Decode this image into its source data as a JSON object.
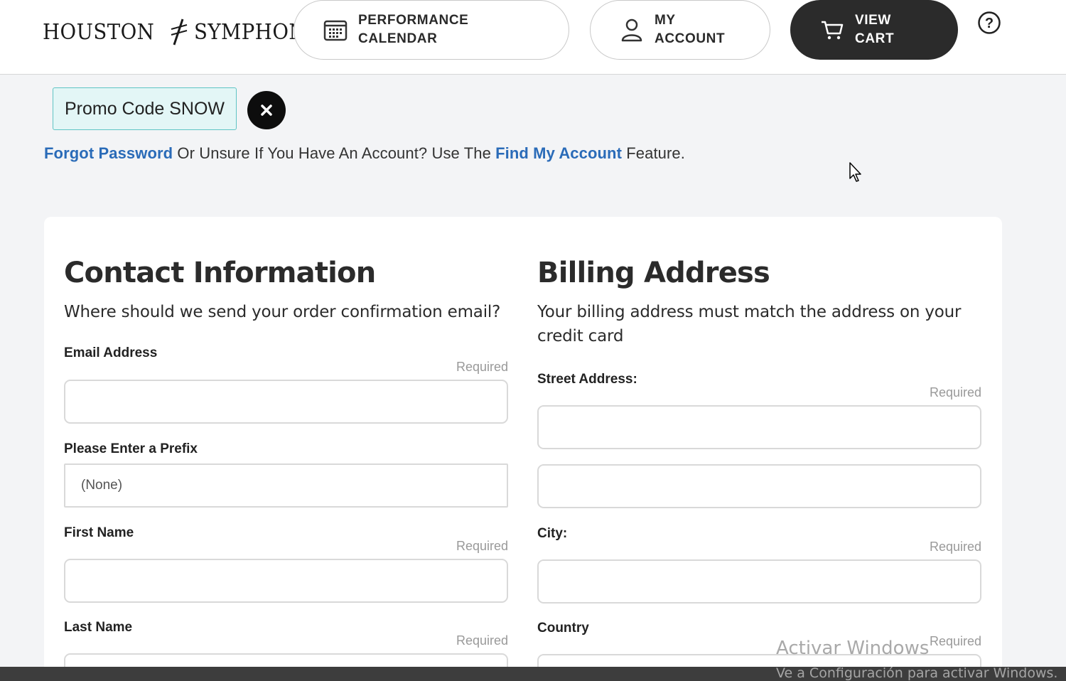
{
  "header": {
    "logo_left": "HOUSTON",
    "logo_right": "SYMPHONY",
    "calendar_label": "PERFORMANCE CALENDAR",
    "account_label": "MY ACCOUNT",
    "cart_label": "VIEW CART",
    "help_icon": "question-circle-icon"
  },
  "promo": {
    "label": "Promo Code SNOW",
    "close_icon": "close-icon"
  },
  "help_line": {
    "forgot_link": "Forgot Password",
    "middle_text": " Or Unsure If You Have An Account? Use The ",
    "find_link": "Find My Account",
    "end_text": " Feature."
  },
  "contact": {
    "title": "Contact Information",
    "subtitle": "Where should we send your order confirmation email?",
    "email_label": "Email Address",
    "email_required": "Required",
    "email_value": "",
    "prefix_label": "Please Enter a Prefix",
    "prefix_value": "(None)",
    "first_name_label": "First Name",
    "first_name_required": "Required",
    "first_name_value": "",
    "last_name_label": "Last Name",
    "last_name_required": "Required"
  },
  "billing": {
    "title": "Billing Address",
    "subtitle": "Your billing address must match the address on your credit card",
    "street_label": "Street Address:",
    "street_required": "Required",
    "street1_value": "",
    "street2_value": "",
    "city_label": "City:",
    "city_required": "Required",
    "city_value": "",
    "country_label": "Country",
    "country_required": "Required"
  },
  "windows": {
    "line1": "Activar Windows",
    "line2": "Ve a Configuración para activar Windows."
  }
}
